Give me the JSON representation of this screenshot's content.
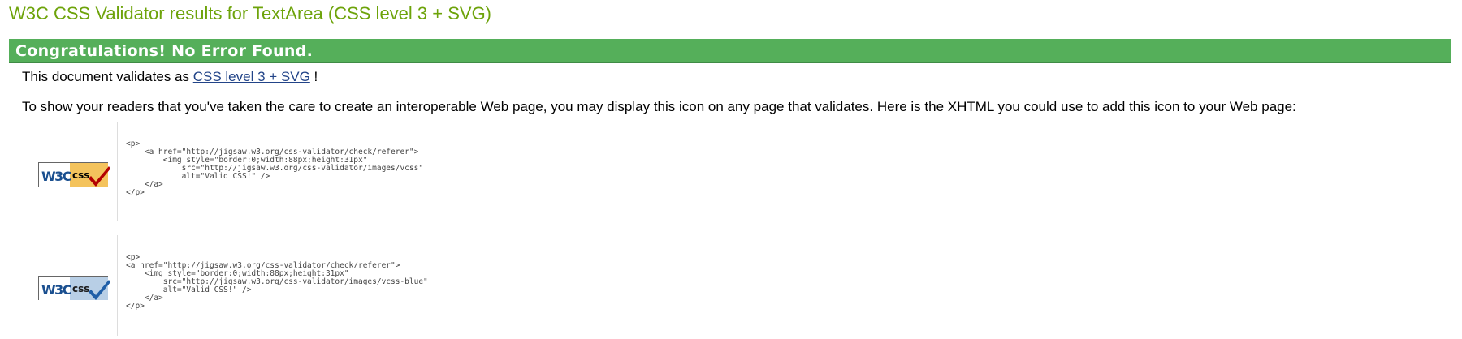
{
  "page": {
    "title": "W3C CSS Validator results for TextArea (CSS level 3 + SVG)"
  },
  "banner": {
    "text": "Congratulations! No Error Found."
  },
  "validates": {
    "prefix": "This document validates as ",
    "link_text": "CSS level 3 + SVG",
    "suffix": " !"
  },
  "icon_intro": "To show your readers that you've taken the care to create an interoperable Web page, you may display this icon on any page that validates. Here is the XHTML you could use to add this icon to your Web page:",
  "badges": [
    {
      "logo_w3c": "W3C",
      "logo_css": "css",
      "check_color": "#b30000",
      "panel_color": "#f4c35c",
      "code": "<p>\n    <a href=\"http://jigsaw.w3.org/css-validator/check/referer\">\n        <img style=\"border:0;width:88px;height:31px\"\n            src=\"http://jigsaw.w3.org/css-validator/images/vcss\"\n            alt=\"Valid CSS!\" />\n    </a>\n</p>"
    },
    {
      "logo_w3c": "W3C",
      "logo_css": "css",
      "check_color": "#1f5fa8",
      "panel_color": "#b8cfe6",
      "code": "<p>\n<a href=\"http://jigsaw.w3.org/css-validator/check/referer\">\n    <img style=\"border:0;width:88px;height:31px\"\n        src=\"http://jigsaw.w3.org/css-validator/images/vcss-blue\"\n        alt=\"Valid CSS!\" />\n    </a>\n</p>"
    }
  ]
}
